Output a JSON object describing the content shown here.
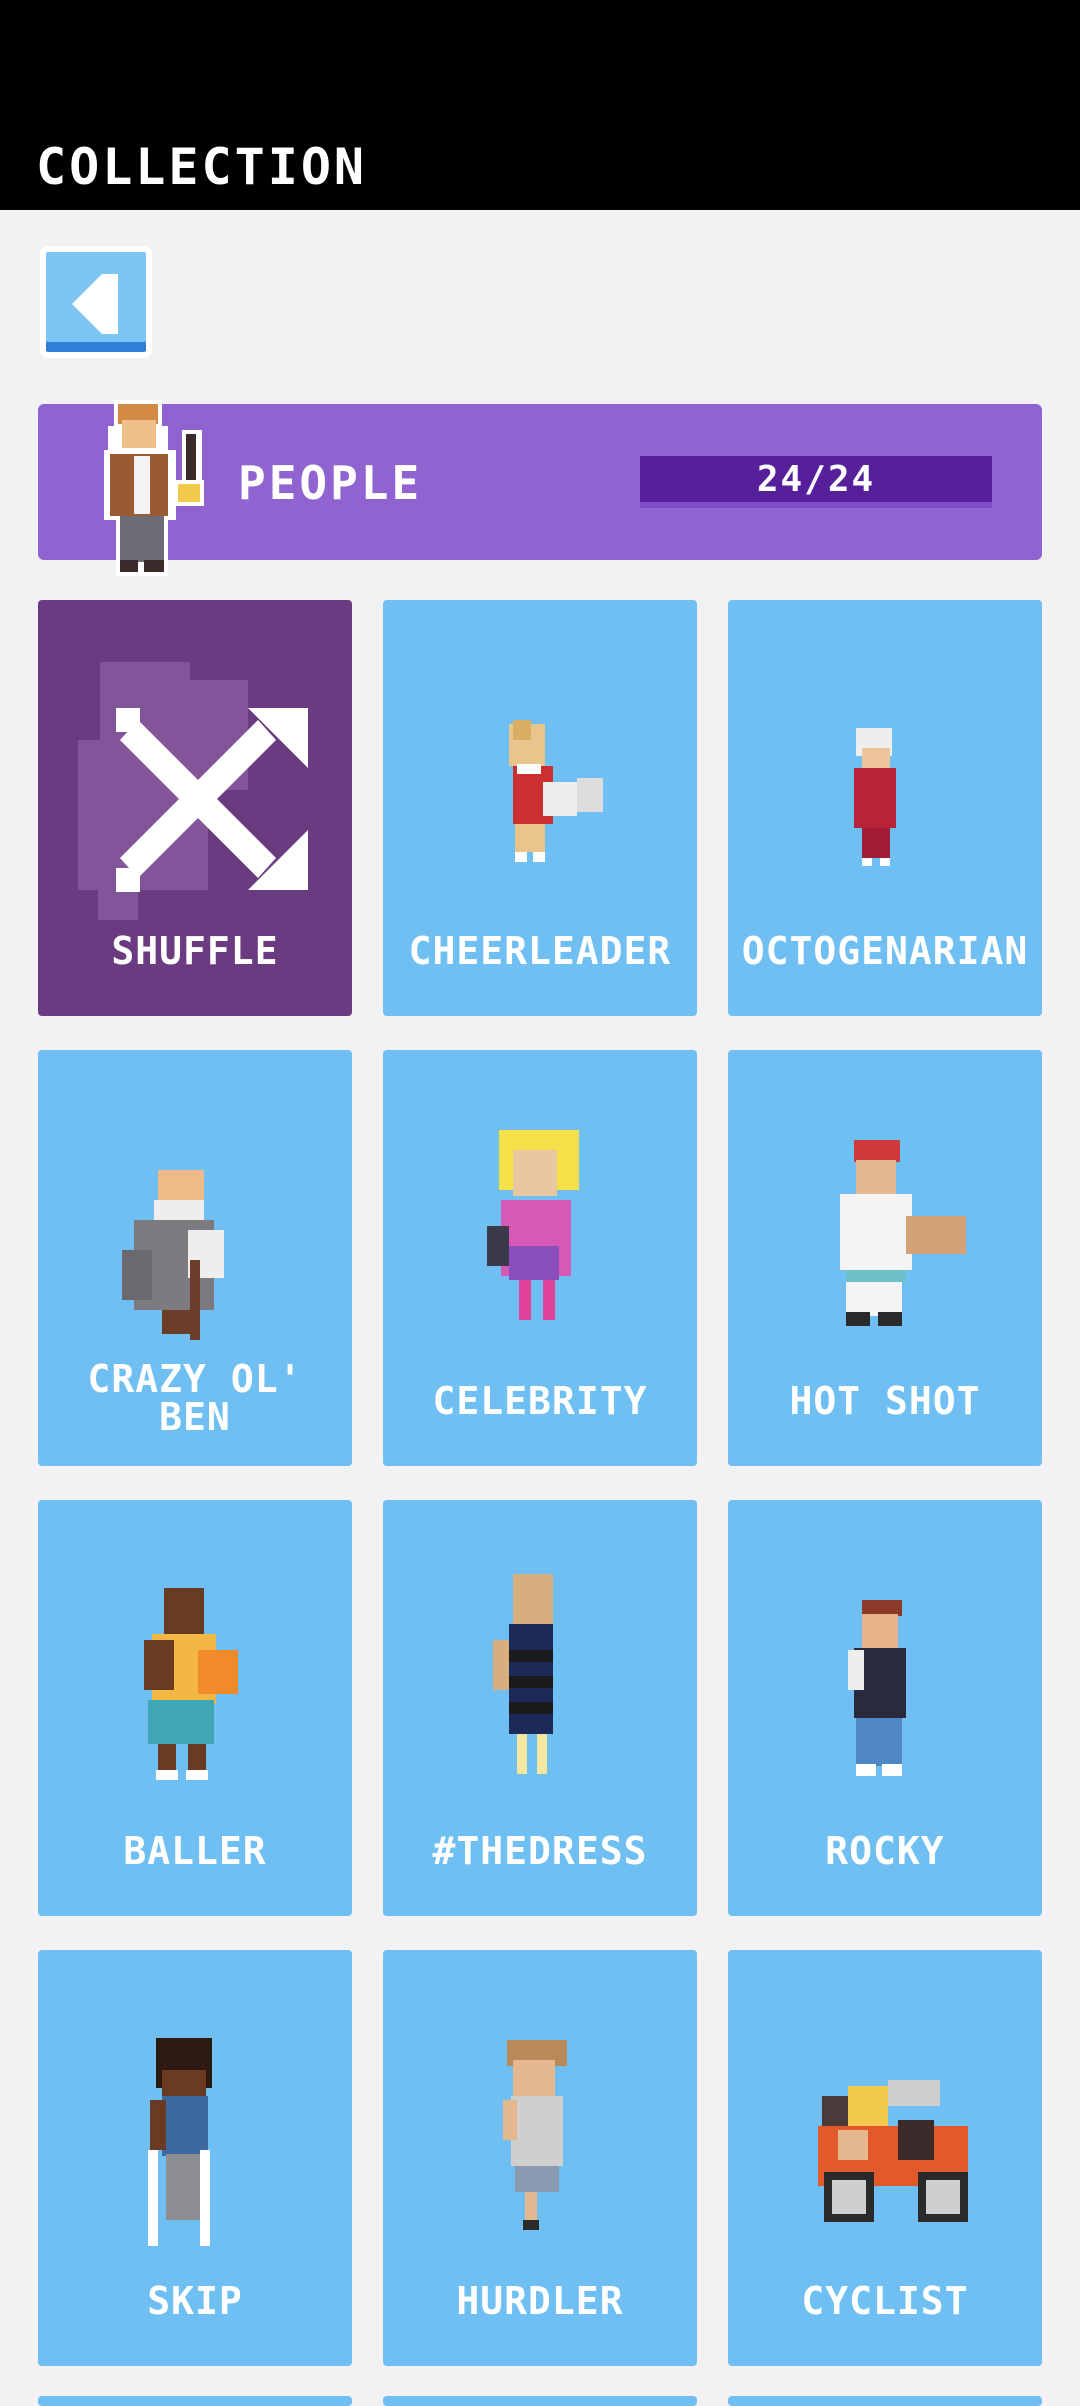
{
  "header": {
    "title": "COLLECTION"
  },
  "back_button": {
    "icon": "back-arrow-icon"
  },
  "category": {
    "label": "PEOPLE",
    "progress_text": "24/24",
    "progress_fraction": 1.0,
    "colors": {
      "banner": "#8f64d1",
      "bar": "#56209a"
    }
  },
  "cards": [
    {
      "name": "SHUFFLE",
      "icon": "shuffle-icon"
    },
    {
      "name": "CHEERLEADER"
    },
    {
      "name": "OCTOGENARIAN"
    },
    {
      "name": "CRAZY OL' BEN"
    },
    {
      "name": "CELEBRITY"
    },
    {
      "name": "HOT SHOT"
    },
    {
      "name": "BALLER"
    },
    {
      "name": "#THEDRESS"
    },
    {
      "name": "ROCKY"
    },
    {
      "name": "SKIP"
    },
    {
      "name": "HURDLER"
    },
    {
      "name": "CYCLIST"
    }
  ],
  "colors": {
    "card": "#6fbff2",
    "shuffle_card": "#6b3b82",
    "top_bar": "#000000",
    "background": "#f2f2f5"
  }
}
